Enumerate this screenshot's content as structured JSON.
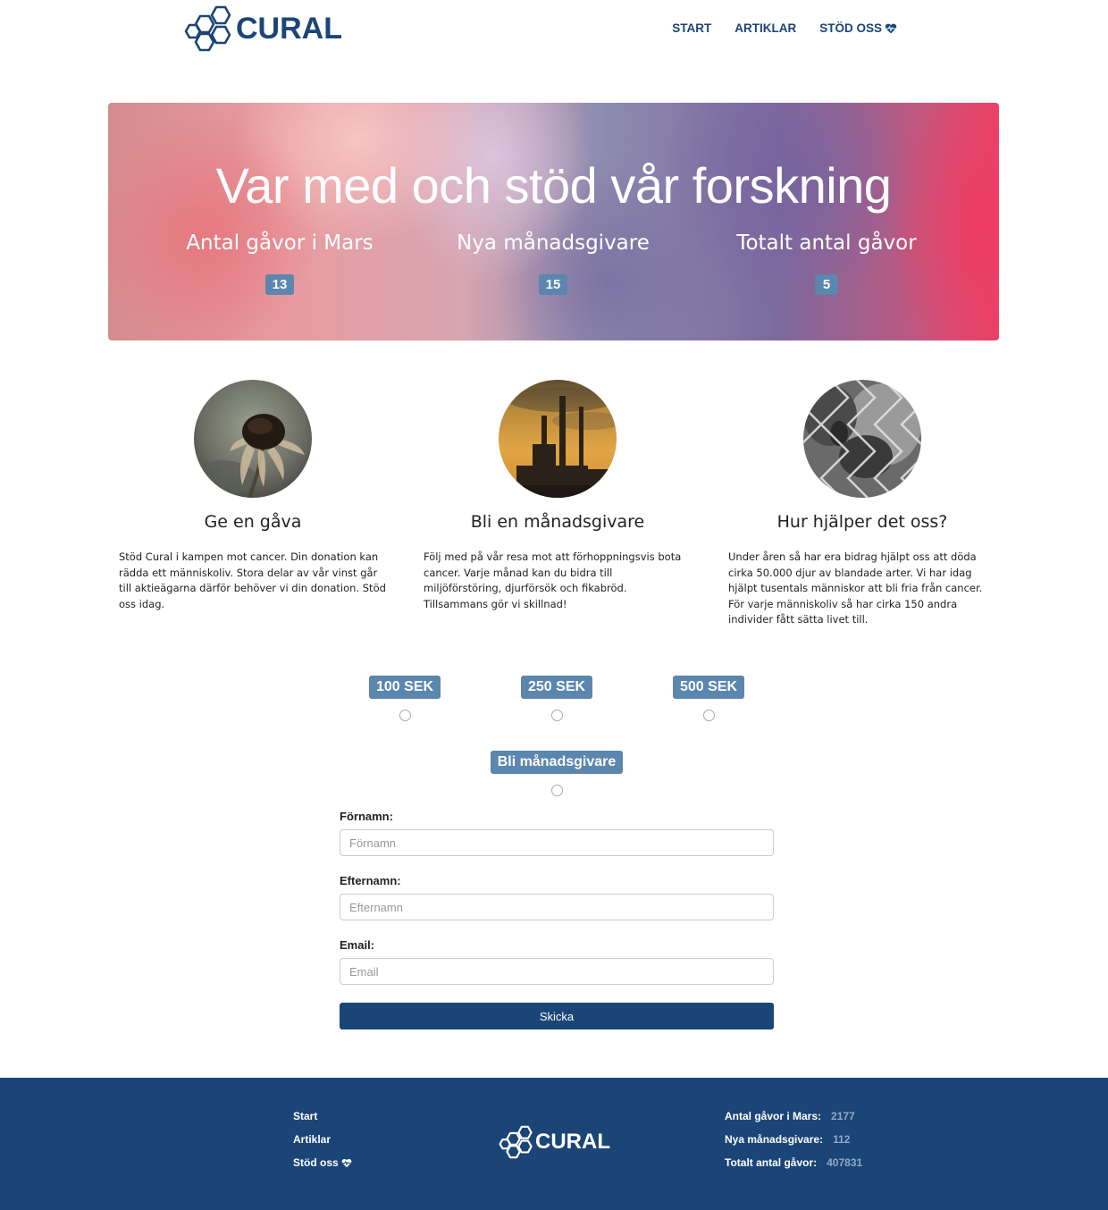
{
  "brand": {
    "name": "CURAL",
    "primary_color": "#1b4577",
    "badge_color": "#5b86ad"
  },
  "nav": {
    "items": [
      {
        "label": "START"
      },
      {
        "label": "ARTIKLAR"
      },
      {
        "label": "STÖD OSS",
        "icon": "heart-pulse-icon"
      }
    ]
  },
  "hero": {
    "title": "Var med och stöd vår forskning",
    "stats": [
      {
        "label": "Antal gåvor i Mars",
        "value": "13"
      },
      {
        "label": "Nya månadsgivare",
        "value": "15"
      },
      {
        "label": "Totalt antal gåvor",
        "value": "5"
      }
    ]
  },
  "features": [
    {
      "title": "Ge en gåva",
      "text": "Stöd Cural i kampen mot cancer. Din donation kan rädda ett människoliv. Stora delar av vår vinst går till aktieägarna därför behöver vi din donation. Stöd oss idag.",
      "image": "wilted-flower-image"
    },
    {
      "title": "Bli en månadsgivare",
      "text": "Följ med på vår resa mot att förhoppningsvis bota cancer. Varje månad kan du bidra till miljöförstöring, djurförsök och fikabröd. Tillsammans gör vi skillnad!",
      "image": "factory-smokestacks-image"
    },
    {
      "title": "Hur hjälper det oss?",
      "text": "Under åren så har era bidrag hjälpt oss att döda cirka 50.000 djur av blandade arter. Vi har idag hjälpt tusentals människor att bli fria från cancer. För varje människoliv så har cirka 150 andra individer fått sätta livet till.",
      "image": "caged-monkey-image"
    }
  ],
  "donation": {
    "amounts": [
      {
        "label": "100 SEK"
      },
      {
        "label": "250 SEK"
      },
      {
        "label": "500 SEK"
      }
    ],
    "monthly_label": "Bli månadsgivare"
  },
  "form": {
    "first_name_label": "Förnamn:",
    "first_name_placeholder": "Förnamn",
    "last_name_label": "Efternamn:",
    "last_name_placeholder": "Efternamn",
    "email_label": "Email:",
    "email_placeholder": "Email",
    "submit_label": "Skicka"
  },
  "footer": {
    "links": [
      {
        "label": "Start"
      },
      {
        "label": "Artiklar"
      },
      {
        "label": "Stöd oss",
        "icon": "heart-pulse-icon"
      }
    ],
    "stats": [
      {
        "label": "Antal gåvor i Mars:",
        "value": "2177"
      },
      {
        "label": "Nya månadsgivare:",
        "value": "112"
      },
      {
        "label": "Totalt antal gåvor:",
        "value": "407831"
      }
    ]
  }
}
